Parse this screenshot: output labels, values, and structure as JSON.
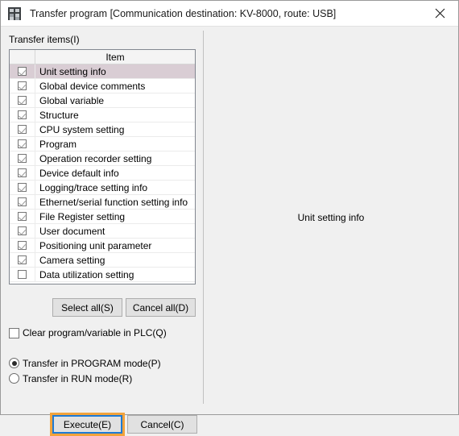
{
  "window": {
    "title": "Transfer program [Communication destination: KV-8000, route: USB]",
    "icon": "app-icon",
    "close_icon": "close-icon"
  },
  "left_pane": {
    "section_label": "Transfer items(I)",
    "list": {
      "columns": [
        "",
        "Item"
      ],
      "rows": [
        {
          "label": "Unit setting info",
          "checked": true,
          "selected": true
        },
        {
          "label": "Global device comments",
          "checked": true,
          "selected": false
        },
        {
          "label": "Global variable",
          "checked": true,
          "selected": false
        },
        {
          "label": "Structure",
          "checked": true,
          "selected": false
        },
        {
          "label": "CPU system setting",
          "checked": true,
          "selected": false
        },
        {
          "label": "Program",
          "checked": true,
          "selected": false
        },
        {
          "label": "Operation recorder setting",
          "checked": true,
          "selected": false
        },
        {
          "label": "Device default info",
          "checked": true,
          "selected": false
        },
        {
          "label": "Logging/trace setting info",
          "checked": true,
          "selected": false
        },
        {
          "label": "Ethernet/serial function setting info",
          "checked": true,
          "selected": false
        },
        {
          "label": "File Register setting",
          "checked": true,
          "selected": false
        },
        {
          "label": "User document",
          "checked": true,
          "selected": false
        },
        {
          "label": "Positioning unit parameter",
          "checked": true,
          "selected": false
        },
        {
          "label": "Camera setting",
          "checked": true,
          "selected": false
        },
        {
          "label": "Data utilization setting",
          "checked": false,
          "selected": false
        }
      ]
    },
    "select_all_label": "Select all(S)",
    "cancel_all_label": "Cancel all(D)",
    "clear_option": {
      "label": "Clear program/variable in PLC(Q)",
      "checked": false
    },
    "transfer_mode": {
      "options": [
        {
          "label": "Transfer in PROGRAM mode(P)",
          "selected": true
        },
        {
          "label": "Transfer in RUN mode(R)",
          "selected": false
        }
      ]
    }
  },
  "preview": {
    "text": "Unit setting info"
  },
  "footer": {
    "execute_label": "Execute(E)",
    "cancel_label": "Cancel(C)"
  },
  "colors": {
    "window_background": "#f0f0f0",
    "titlebar_background": "#ffffff",
    "selected_row": "#d9cdd4",
    "focus_border": "#1e7ad4",
    "highlight_border": "#f2a33c",
    "button_face": "#e1e1e1"
  }
}
